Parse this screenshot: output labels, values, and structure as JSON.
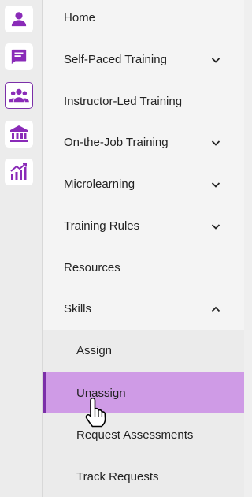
{
  "rail": {
    "items": [
      {
        "icon": "person-icon",
        "active": false
      },
      {
        "icon": "message-icon",
        "active": false
      },
      {
        "icon": "group-icon",
        "active": true
      },
      {
        "icon": "institution-icon",
        "active": false
      },
      {
        "icon": "analytics-icon",
        "active": false
      }
    ],
    "accent": "#7b2fa8"
  },
  "menu": {
    "items": [
      {
        "label": "Home",
        "chevron": "none"
      },
      {
        "label": "Self-Paced Training",
        "chevron": "down"
      },
      {
        "label": "Instructor-Led Training",
        "chevron": "none"
      },
      {
        "label": "On-the-Job Training",
        "chevron": "down"
      },
      {
        "label": "Microlearning",
        "chevron": "down"
      },
      {
        "label": "Training Rules",
        "chevron": "down"
      },
      {
        "label": "Resources",
        "chevron": "none"
      },
      {
        "label": "Skills",
        "chevron": "up"
      }
    ],
    "skills_submenu": [
      {
        "label": "Assign",
        "selected": false
      },
      {
        "label": "Unassign",
        "selected": true
      },
      {
        "label": "Request Assessments",
        "selected": false
      },
      {
        "label": "Track Requests",
        "selected": false
      }
    ]
  },
  "colors": {
    "selected_bg": "#cf9be6",
    "selected_border": "#7b2fa8",
    "icon": "#8a2bb8"
  },
  "cursor": "hand-pointer"
}
